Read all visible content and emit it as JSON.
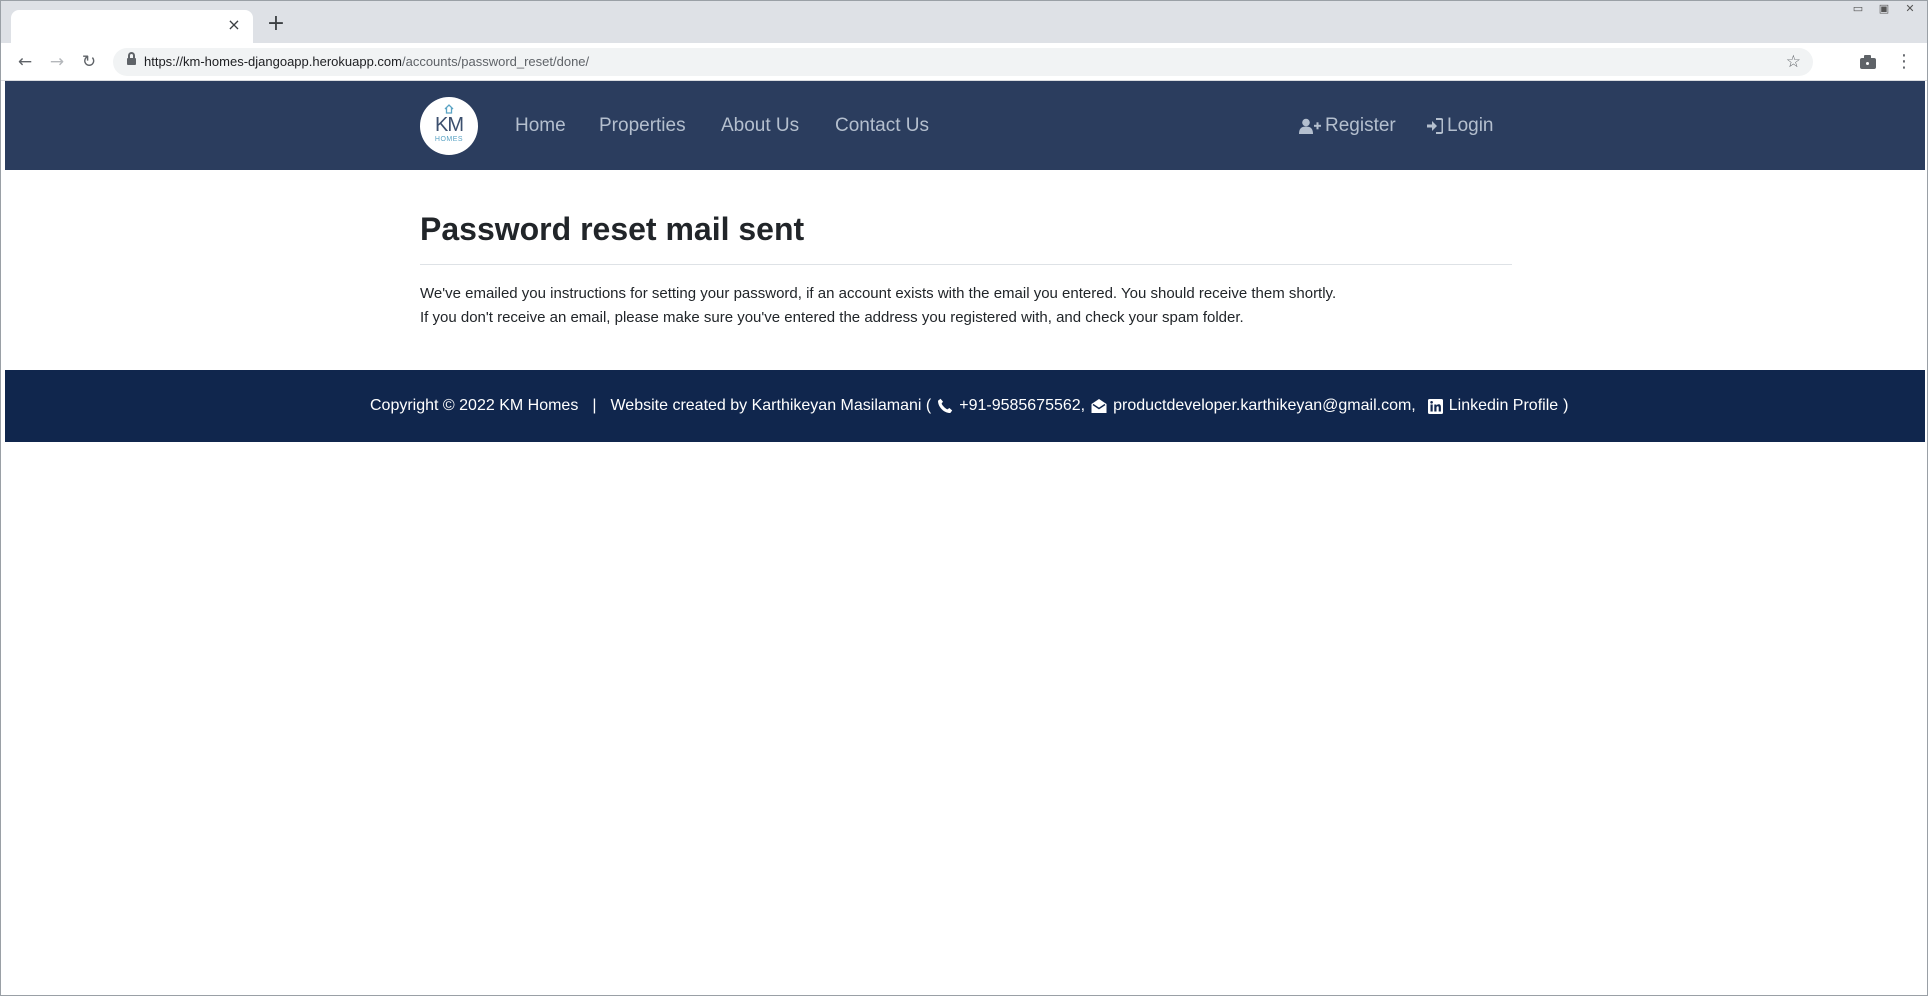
{
  "browser": {
    "tab_close_icon": "×",
    "new_tab_icon": "+",
    "window_controls": [
      "▭",
      "▣",
      "✕"
    ],
    "back_icon": "←",
    "forward_icon": "→",
    "reload_icon": "↻",
    "url_host": "https://km-homes-djangoapp.herokuapp.com",
    "url_path": "/accounts/password_reset/done/",
    "star_icon": "☆",
    "menu_icon": "⋮"
  },
  "nav": {
    "logo_text": "KM",
    "logo_subtext": "HOMES",
    "links": [
      "Home",
      "Properties",
      "About Us",
      "Contact Us"
    ],
    "register_label": "Register",
    "login_label": "Login"
  },
  "main": {
    "title": "Password reset mail sent",
    "paragraph_1": "We've emailed you instructions for setting your password, if an account exists with the email you entered. You should receive them shortly.",
    "paragraph_2": "If you don't receive an email, please make sure you've entered the address you registered with, and check your spam folder."
  },
  "footer": {
    "copyright": "Copyright © 2022 KM Homes",
    "separator": "|",
    "created_by": "Website created by Karthikeyan Masilamani (",
    "phone": "+91-9585675562,",
    "email": "productdeveloper.karthikeyan@gmail.com,",
    "linkedin": "Linkedin Profile",
    "close_paren": ")"
  },
  "colors": {
    "navbar": "#2b3d5e",
    "footer": "#10264d",
    "nav_link": "#b4bfce"
  }
}
